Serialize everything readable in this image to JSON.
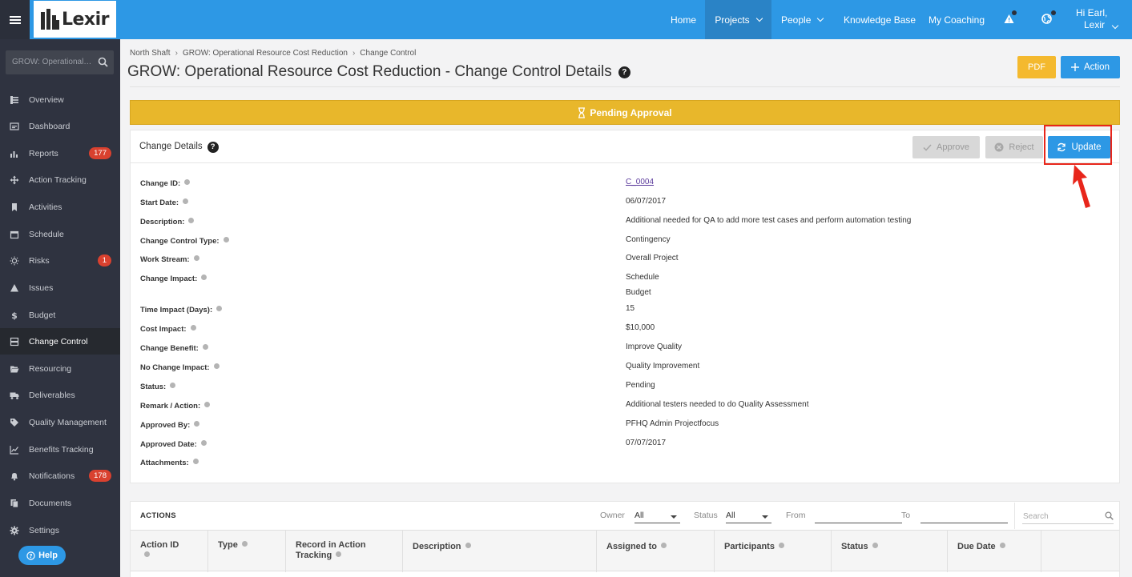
{
  "app": {
    "logo_text": "Lexir"
  },
  "topnav": {
    "items": [
      {
        "label": "Home"
      },
      {
        "label": "Projects"
      },
      {
        "label": "People"
      },
      {
        "label": "Knowledge Base"
      },
      {
        "label": "My Coaching"
      }
    ],
    "user_line1": "Hi Earl,",
    "user_line2": "Lexir"
  },
  "sidebar": {
    "search_placeholder": "GROW: Operational Resource Cost Reduction",
    "items": [
      {
        "label": "Overview",
        "icon": "overview-icon"
      },
      {
        "label": "Dashboard",
        "icon": "dashboard-icon"
      },
      {
        "label": "Reports",
        "icon": "bar-chart-icon",
        "badge": "177"
      },
      {
        "label": "Action Tracking",
        "icon": "move-icon"
      },
      {
        "label": "Activities",
        "icon": "bookmark-icon"
      },
      {
        "label": "Schedule",
        "icon": "calendar-icon"
      },
      {
        "label": "Risks",
        "icon": "lightbulb-icon",
        "badge": "1"
      },
      {
        "label": "Issues",
        "icon": "warning-icon"
      },
      {
        "label": "Budget",
        "icon": "dollar-icon"
      },
      {
        "label": "Change Control",
        "icon": "server-icon"
      },
      {
        "label": "Resourcing",
        "icon": "folder-open-icon"
      },
      {
        "label": "Deliverables",
        "icon": "truck-icon"
      },
      {
        "label": "Quality Management",
        "icon": "tag-icon"
      },
      {
        "label": "Benefits Tracking",
        "icon": "line-chart-icon"
      },
      {
        "label": "Notifications",
        "icon": "bell-icon",
        "badge": "178"
      },
      {
        "label": "Documents",
        "icon": "documents-icon"
      },
      {
        "label": "Settings",
        "icon": "gear-icon"
      }
    ],
    "help_label": "Help"
  },
  "breadcrumb": [
    "North Shaft",
    "GROW: Operational Resource Cost Reduction",
    "Change Control"
  ],
  "page_title": "GROW: Operational Resource Cost Reduction - Change Control Details",
  "header_buttons": {
    "pdf": "PDF",
    "action": "Action"
  },
  "status_banner": "Pending Approval",
  "details_panel": {
    "title": "Change Details",
    "approve": "Approve",
    "reject": "Reject",
    "update": "Update",
    "rows": [
      {
        "label": "Change ID:",
        "value": "C_0004"
      },
      {
        "label": "Start Date:",
        "value": "06/07/2017"
      },
      {
        "label": "Description:",
        "value": "Additional needed for QA to add more test cases and perform automation testing"
      },
      {
        "label": "Change Control Type:",
        "value": "Contingency"
      },
      {
        "label": "Work Stream:",
        "value": "Overall Project"
      },
      {
        "label": "Change Impact:",
        "value": "Schedule",
        "value2": "Budget"
      },
      {
        "label": "Time Impact (Days):",
        "value": "15"
      },
      {
        "label": "Cost Impact:",
        "value": "$10,000"
      },
      {
        "label": "Change Benefit:",
        "value": "Improve Quality"
      },
      {
        "label": "No Change Impact:",
        "value": "Quality Improvement"
      },
      {
        "label": "Status:",
        "value": "Pending"
      },
      {
        "label": "Remark / Action:",
        "value": "Additional testers needed to do Quality Assessment"
      },
      {
        "label": "Approved By:",
        "value": "PFHQ Admin Projectfocus"
      },
      {
        "label": "Approved Date:",
        "value": "07/07/2017"
      },
      {
        "label": "Attachments:",
        "value": ""
      }
    ]
  },
  "actions_panel": {
    "title": "ACTIONS",
    "owner_label": "Owner",
    "owner_value": "All",
    "status_label": "Status",
    "status_value": "All",
    "from_label": "From",
    "to_label": "To",
    "search_placeholder": "Search",
    "columns": [
      "Action ID",
      "Type",
      "Record in Action Tracking",
      "Description",
      "Assigned to",
      "Participants",
      "Status",
      "Due Date"
    ]
  },
  "colors": {
    "primary": "#2d98e5",
    "sidebar": "#2f3340",
    "pending": "#e8b72b",
    "pdf": "#f4b92e",
    "badge": "#d9412f",
    "highlight": "#e8261b"
  }
}
